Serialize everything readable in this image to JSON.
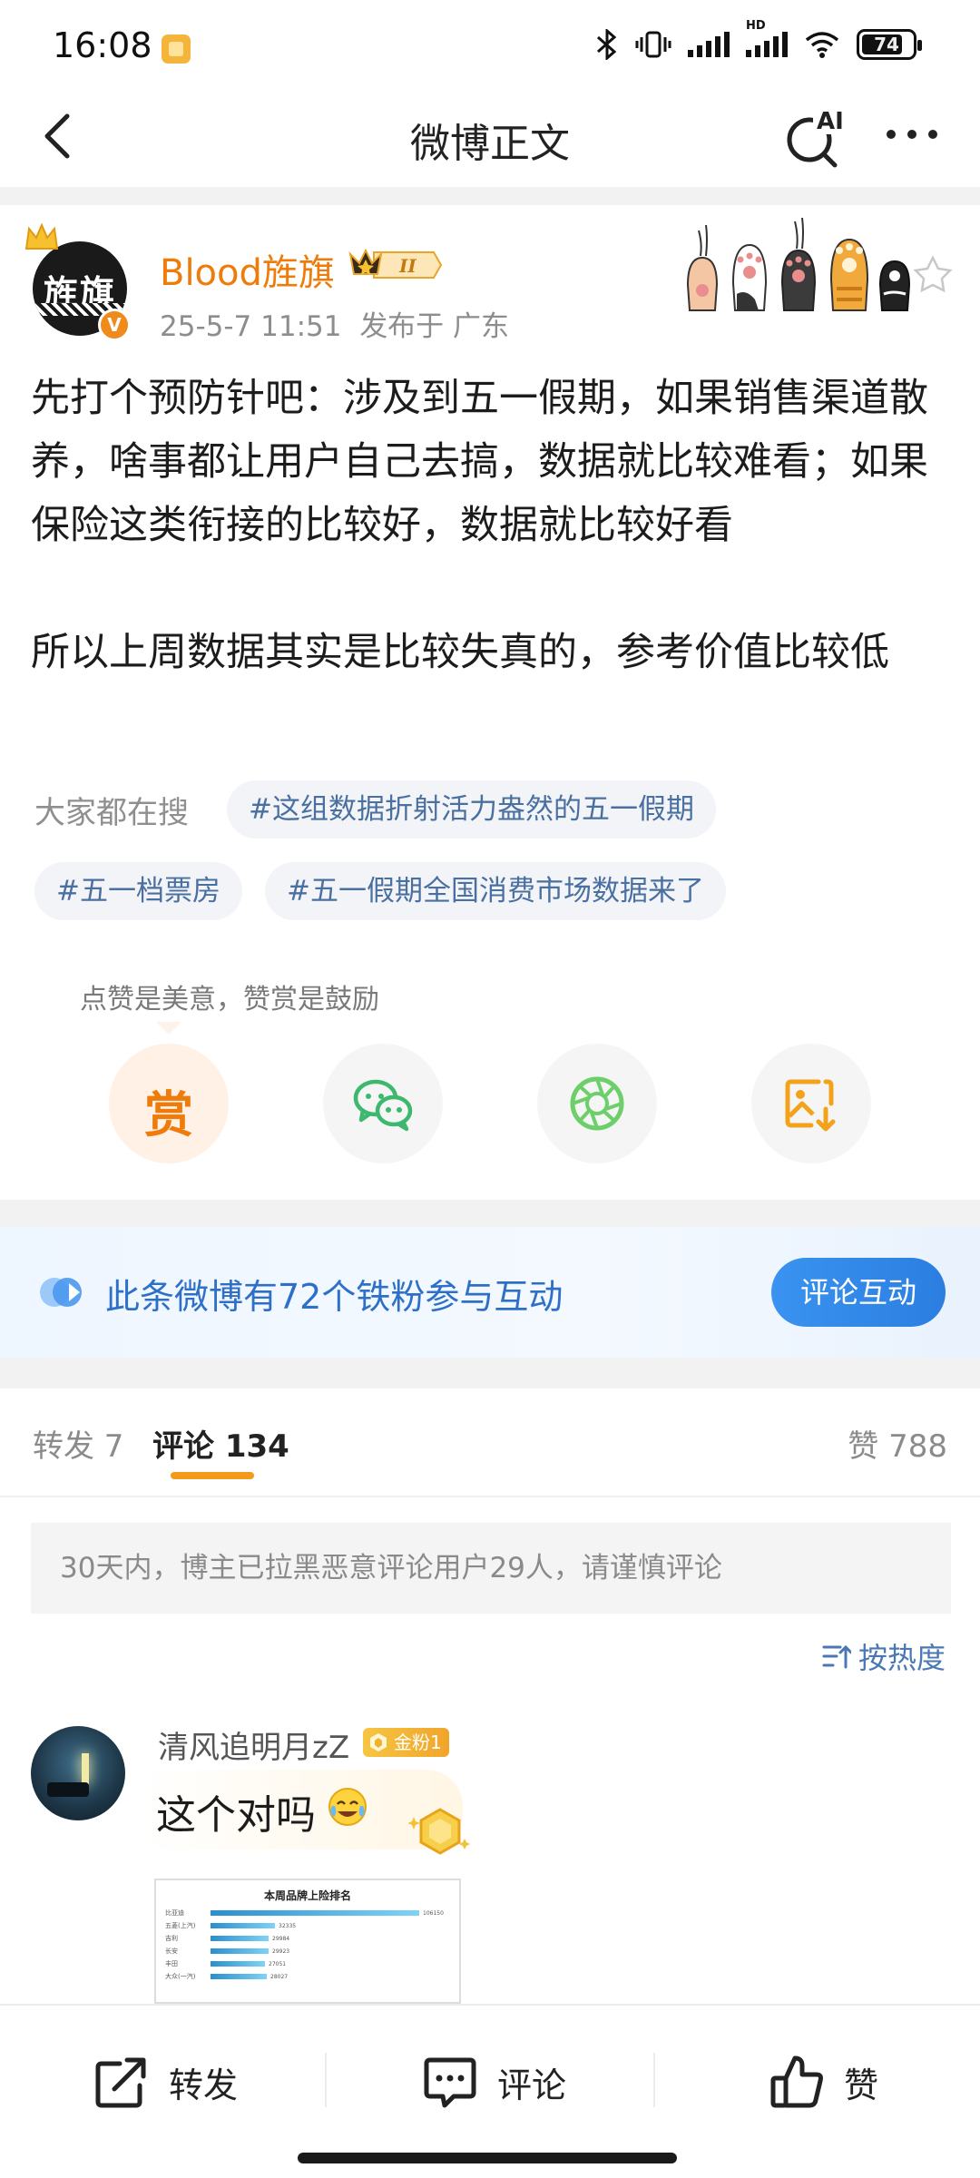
{
  "status_bar": {
    "time": "16:08",
    "battery": "74",
    "icons": [
      "bluetooth-icon",
      "vibrate-icon",
      "signal-icon",
      "hd-signal-icon",
      "wifi-icon",
      "battery-icon"
    ]
  },
  "nav": {
    "title": "微博正文",
    "ai_label": "AI"
  },
  "author": {
    "name": "Blood旌旗",
    "avatar_text": "旌旗",
    "level": "II",
    "time": "25-5-7 11:51",
    "location": "发布于 广东"
  },
  "post": {
    "text": "先打个预防针吧：涉及到五一假期，如果销售渠道散养，啥事都让用户自己去搞，数据就比较难看；如果保险这类衔接的比较好，数据就比较好看\n\n所以上周数据其实是比较失真的，参考价值比较低"
  },
  "hot_search": {
    "label": "大家都在搜",
    "topics": [
      "#这组数据折射活力盎然的五一假期",
      "#五一档票房",
      "#五一假期全国消费市场数据来了"
    ]
  },
  "reward": {
    "tip": "点赞是美意，赞赏是鼓励",
    "label": "赏"
  },
  "fans_banner": {
    "text": "此条微博有72个铁粉参与互动",
    "button": "评论互动"
  },
  "tabs": {
    "repost": "转发 7",
    "comment": "评论 134",
    "like": "赞 788"
  },
  "notice": "30天内，博主已拉黑恶意评论用户29人，请谨慎评论",
  "sort_label": "按热度",
  "comment": {
    "user": "清风追明月zZ",
    "badge": "金粉1",
    "text": "这个对吗",
    "image": {
      "title": "本周品牌上险排名",
      "rows": [
        {
          "label": "比亚迪",
          "value": "106150",
          "fill": 1.0
        },
        {
          "label": "五菱(上汽)",
          "value": "32335",
          "fill": 0.31
        },
        {
          "label": "吉利",
          "value": "29984",
          "fill": 0.28
        },
        {
          "label": "长安",
          "value": "29923",
          "fill": 0.28
        },
        {
          "label": "丰田",
          "value": "27051",
          "fill": 0.26
        },
        {
          "label": "大众(一汽)",
          "value": "28027",
          "fill": 0.27
        }
      ]
    }
  },
  "bottom_bar": {
    "repost": "转发",
    "comment": "评论",
    "like": "赞"
  }
}
